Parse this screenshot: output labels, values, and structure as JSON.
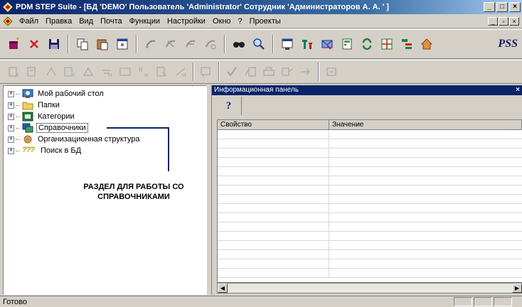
{
  "window": {
    "title": "PDM STEP Suite - [БД 'DEMO' Пользователь 'Administrator' Сотрудник 'Администраторов А. А. ' ]",
    "minimize": "_",
    "maximize": "□",
    "close": "×"
  },
  "menu": {
    "items": [
      {
        "label": "Файл"
      },
      {
        "label": "Правка"
      },
      {
        "label": "Вид"
      },
      {
        "label": "Почта"
      },
      {
        "label": "Функции"
      },
      {
        "label": "Настройки"
      },
      {
        "label": "Окно"
      },
      {
        "label": "?"
      },
      {
        "label": "Проекты"
      }
    ],
    "mdi_minimize": "_",
    "mdi_restore": "▫",
    "mdi_close": "×"
  },
  "toolbar": {
    "brand": "PSS",
    "row1_icons": [
      "new-object-icon",
      "delete-icon",
      "save-icon",
      "copy-icon",
      "paste-icon",
      "properties-icon",
      "link-icon",
      "link-add-icon",
      "link-remove-icon",
      "link-edit-icon",
      "find-icon",
      "search-icon",
      "view-icon",
      "filter-icon",
      "mail-icon",
      "calculator-icon",
      "refresh-icon",
      "structure-icon",
      "tree-icon",
      "home-icon"
    ],
    "row2_icons": [
      "doc-a-icon",
      "doc-b-icon",
      "doc-c-icon",
      "doc-d-icon",
      "doc-e-icon",
      "doc-f-icon",
      "doc-g-icon",
      "doc-h-icon",
      "doc-i-icon",
      "doc-j-icon",
      "doc-k-icon",
      "approve-icon",
      "edit-doc-icon",
      "print-icon",
      "route-icon",
      "export-icon",
      "filter2-icon"
    ]
  },
  "tree": {
    "items": [
      {
        "label": "Мой рабочий стол",
        "icon": "desktop-icon",
        "expander": "+"
      },
      {
        "label": "Папки",
        "icon": "folder-icon",
        "expander": "+"
      },
      {
        "label": "Категории",
        "icon": "categories-icon",
        "expander": "+"
      },
      {
        "label": "Справочники",
        "icon": "reference-books-icon",
        "expander": "+",
        "selected": true
      },
      {
        "label": "Организационная структура",
        "icon": "org-structure-icon",
        "expander": "+"
      },
      {
        "label": "Поиск в БД",
        "icon": "db-search-icon",
        "expander": "+",
        "icon_text": "???"
      }
    ]
  },
  "annotation": {
    "line1": "РАЗДЕЛ ДЛЯ РАБОТЫ СО",
    "line2": "СПРАВОЧНИКАМИ"
  },
  "info_panel": {
    "title": "Информационная панель",
    "close": "×",
    "help_tab": "?",
    "columns": [
      "Свойство",
      "Значение"
    ],
    "row_count": 16
  },
  "status": {
    "text": "Готово"
  },
  "colors": {
    "title_bar": "#0a246a",
    "face": "#d4d0c8",
    "annotation_line": "#0a246a"
  }
}
